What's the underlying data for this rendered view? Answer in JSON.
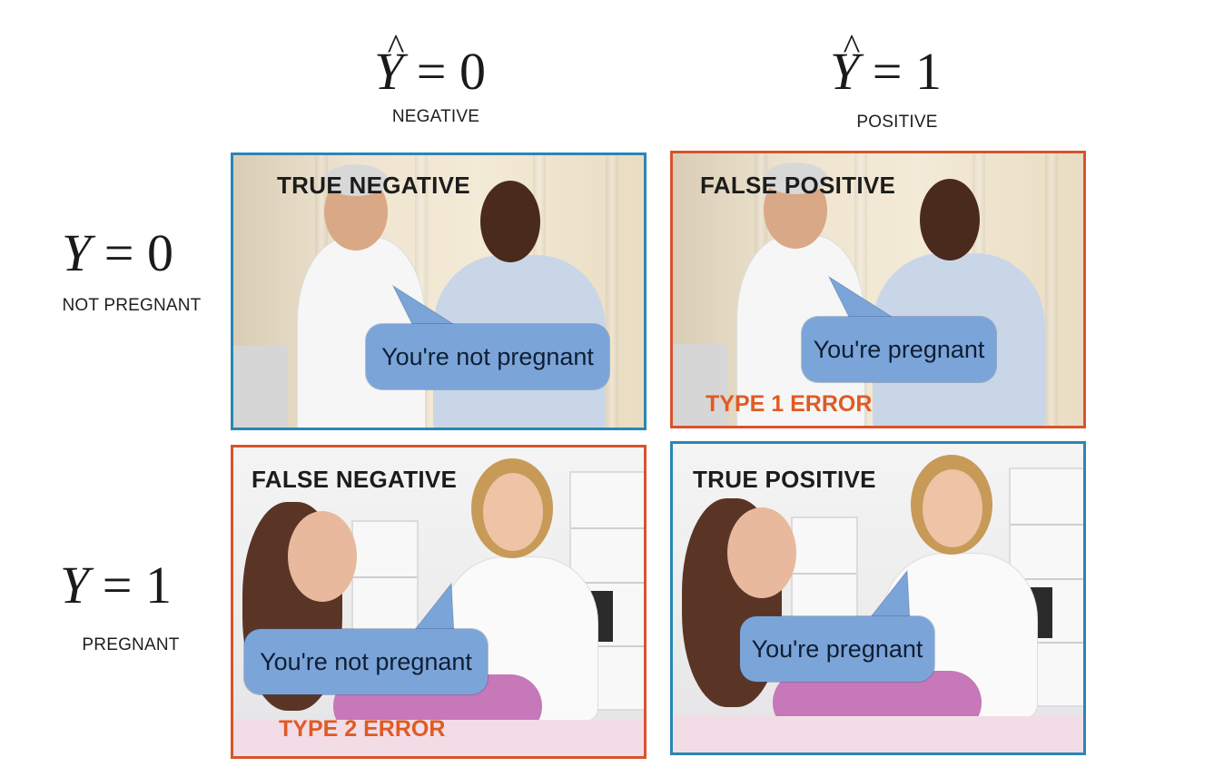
{
  "columns": [
    {
      "math_symbol": "Y",
      "math_rhs": "= 0",
      "caption": "NEGATIVE"
    },
    {
      "math_symbol": "Y",
      "math_rhs": "= 1",
      "caption": "POSITIVE"
    }
  ],
  "rows": [
    {
      "math_symbol": "Y",
      "math_rhs": "= 0",
      "caption": "NOT PREGNANT"
    },
    {
      "math_symbol": "Y",
      "math_rhs": "= 1",
      "caption": "PREGNANT"
    }
  ],
  "cells": {
    "true_negative": {
      "title": "TRUE NEGATIVE",
      "bubble": "You're not pregnant",
      "error": ""
    },
    "false_positive": {
      "title": "FALSE POSITIVE",
      "bubble": "You're pregnant",
      "error": "TYPE 1 ERROR"
    },
    "false_negative": {
      "title": "FALSE NEGATIVE",
      "bubble": "You're not pregnant",
      "error": "TYPE 2 ERROR"
    },
    "true_positive": {
      "title": "TRUE POSITIVE",
      "bubble": "You're pregnant",
      "error": ""
    }
  },
  "colors": {
    "correct_border": "#2a86b4",
    "error_border": "#d9532c",
    "error_text": "#e05a24",
    "bubble_fill": "#7ba5d9"
  }
}
